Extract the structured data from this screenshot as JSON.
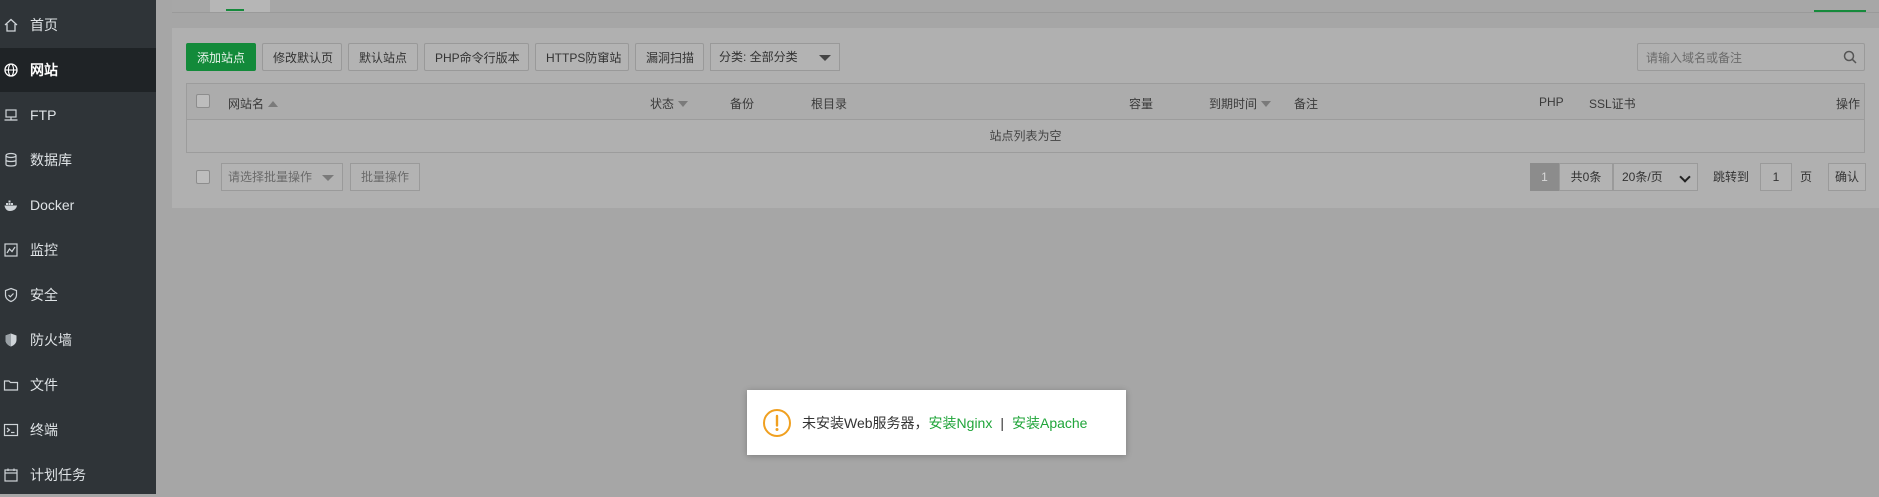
{
  "sidebar": {
    "items": [
      {
        "label": "首页",
        "icon": "home-icon"
      },
      {
        "label": "网站",
        "icon": "globe-icon",
        "active": true
      },
      {
        "label": "FTP",
        "icon": "ftp-icon"
      },
      {
        "label": "数据库",
        "icon": "database-icon"
      },
      {
        "label": "Docker",
        "icon": "docker-icon"
      },
      {
        "label": "监控",
        "icon": "monitor-icon"
      },
      {
        "label": "安全",
        "icon": "shield-icon"
      },
      {
        "label": "防火墙",
        "icon": "firewall-icon"
      },
      {
        "label": "文件",
        "icon": "folder-icon"
      },
      {
        "label": "终端",
        "icon": "terminal-icon"
      },
      {
        "label": "计划任务",
        "icon": "calendar-icon"
      }
    ]
  },
  "toolbar": {
    "add_site": "添加站点",
    "edit_default_page": "修改默认页",
    "default_site": "默认站点",
    "php_cli_version": "PHP命令行版本",
    "https_anti_hijack": "HTTPS防窜站",
    "vuln_scan": "漏洞扫描",
    "category_select": "分类: 全部分类"
  },
  "search": {
    "placeholder": "请输入域名或备注"
  },
  "table": {
    "columns": {
      "site_name": "网站名",
      "status": "状态",
      "backup": "备份",
      "root_dir": "根目录",
      "capacity": "容量",
      "expire": "到期时间",
      "remark": "备注",
      "php": "PHP",
      "ssl": "SSL证书",
      "action": "操作"
    },
    "empty_text": "站点列表为空"
  },
  "footer": {
    "batch_select_placeholder": "请选择批量操作",
    "batch_button": "批量操作",
    "current_page": "1",
    "total": "共0条",
    "page_size": "20条/页",
    "jump_label": "跳转到",
    "jump_value": "1",
    "page_unit": "页",
    "confirm": "确认"
  },
  "dialog": {
    "message": "未安装Web服务器，",
    "install_nginx": "安装Nginx",
    "separator": "|",
    "install_apache": "安装Apache"
  },
  "colors": {
    "brand_green": "#20a53a",
    "warning_orange": "#f0a020",
    "sidebar_bg": "#2f3438"
  }
}
